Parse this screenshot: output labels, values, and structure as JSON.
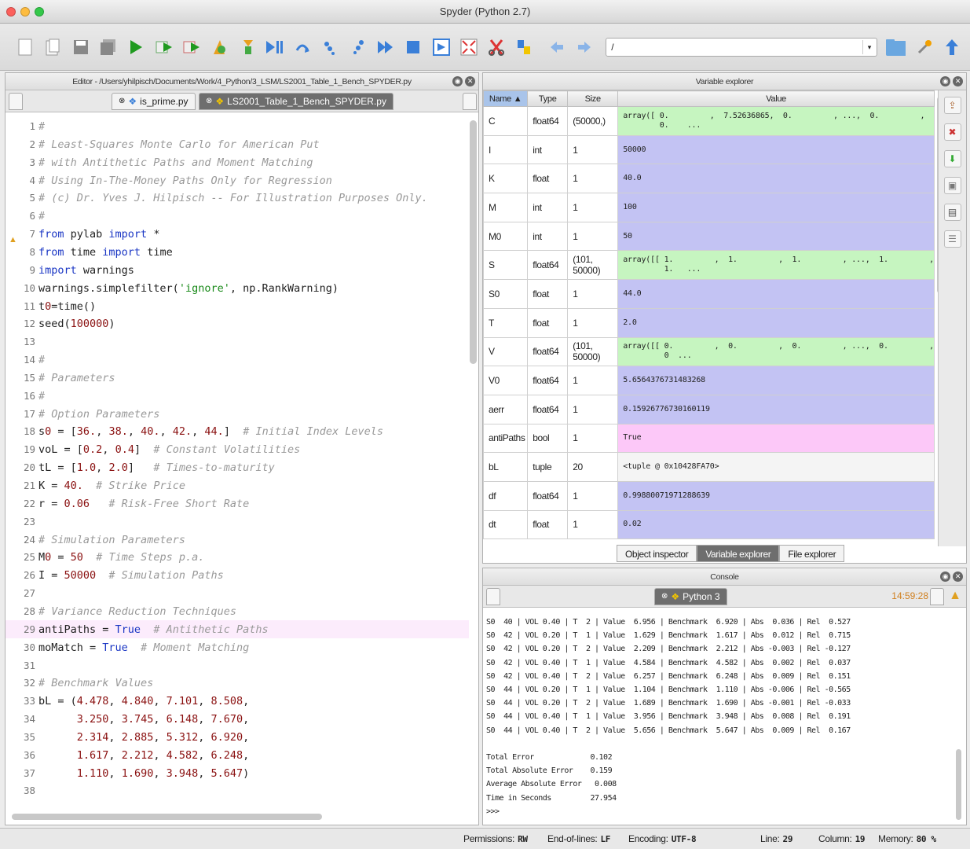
{
  "window": {
    "title": "Spyder (Python 2.7)"
  },
  "toolbar": {
    "path_value": "/"
  },
  "editor": {
    "header": "Editor - /Users/yhilpisch/Documents/Work/4_Python/3_LSM/LS2001_Table_1_Bench_SPYDER.py",
    "tabs": [
      "is_prime.py",
      "LS2001_Table_1_Bench_SPYDER.py"
    ],
    "lines": [
      {
        "n": "1",
        "t": "#"
      },
      {
        "n": "2",
        "t": "# Least-Squares Monte Carlo for American Put"
      },
      {
        "n": "3",
        "t": "# with Antithetic Paths and Moment Matching"
      },
      {
        "n": "4",
        "t": "# Using In-The-Money Paths Only for Regression"
      },
      {
        "n": "5",
        "t": "# (c) Dr. Yves J. Hilpisch -- For Illustration Purposes Only."
      },
      {
        "n": "6",
        "t": "#"
      },
      {
        "n": "7",
        "t": "from pylab import *"
      },
      {
        "n": "8",
        "t": "from time import time"
      },
      {
        "n": "9",
        "t": "import warnings"
      },
      {
        "n": "10",
        "t": "warnings.simplefilter('ignore', np.RankWarning)"
      },
      {
        "n": "11",
        "t": "t0=time()"
      },
      {
        "n": "12",
        "t": "seed(100000)"
      },
      {
        "n": "13",
        "t": ""
      },
      {
        "n": "14",
        "t": "#"
      },
      {
        "n": "15",
        "t": "# Parameters"
      },
      {
        "n": "16",
        "t": "#"
      },
      {
        "n": "17",
        "t": "# Option Parameters"
      },
      {
        "n": "18",
        "t": "s0 = [36., 38., 40., 42., 44.]  # Initial Index Levels"
      },
      {
        "n": "19",
        "t": "voL = [0.2, 0.4]  # Constant Volatilities"
      },
      {
        "n": "20",
        "t": "tL = [1.0, 2.0]   # Times-to-maturity"
      },
      {
        "n": "21",
        "t": "K = 40.  # Strike Price"
      },
      {
        "n": "22",
        "t": "r = 0.06   # Risk-Free Short Rate"
      },
      {
        "n": "23",
        "t": ""
      },
      {
        "n": "24",
        "t": "# Simulation Parameters"
      },
      {
        "n": "25",
        "t": "M0 = 50  # Time Steps p.a."
      },
      {
        "n": "26",
        "t": "I = 50000  # Simulation Paths"
      },
      {
        "n": "27",
        "t": ""
      },
      {
        "n": "28",
        "t": "# Variance Reduction Techniques"
      },
      {
        "n": "29",
        "t": "antiPaths = True  # Antithetic Paths"
      },
      {
        "n": "30",
        "t": "moMatch = True  # Moment Matching"
      },
      {
        "n": "31",
        "t": ""
      },
      {
        "n": "32",
        "t": "# Benchmark Values"
      },
      {
        "n": "33",
        "t": "bL = (4.478, 4.840, 7.101, 8.508,"
      },
      {
        "n": "34",
        "t": "      3.250, 3.745, 6.148, 7.670,"
      },
      {
        "n": "35",
        "t": "      2.314, 2.885, 5.312, 6.920,"
      },
      {
        "n": "36",
        "t": "      1.617, 2.212, 4.582, 6.248,"
      },
      {
        "n": "37",
        "t": "      1.110, 1.690, 3.948, 5.647)"
      },
      {
        "n": "38",
        "t": ""
      }
    ]
  },
  "variable_explorer": {
    "header": "Variable explorer",
    "columns": [
      "Name",
      "Type",
      "Size",
      "Value"
    ],
    "rows": [
      {
        "name": "C",
        "type": "float64",
        "size": "(50000,)",
        "value": "array([ 0.         ,  7.52636865,  0.         , ...,  0.         ,\n        0.    ...",
        "color": "#c6f5c0"
      },
      {
        "name": "I",
        "type": "int",
        "size": "1",
        "value": "50000",
        "color": "#c3c3f3"
      },
      {
        "name": "K",
        "type": "float",
        "size": "1",
        "value": "40.0",
        "color": "#c3c3f3"
      },
      {
        "name": "M",
        "type": "int",
        "size": "1",
        "value": "100",
        "color": "#c3c3f3"
      },
      {
        "name": "M0",
        "type": "int",
        "size": "1",
        "value": "50",
        "color": "#c3c3f3"
      },
      {
        "name": "S",
        "type": "float64",
        "size": "(101, 50000)",
        "value": "array([[ 1.         ,  1.         ,  1.         , ...,  1.         ,\n         1.   ...",
        "color": "#c6f5c0"
      },
      {
        "name": "S0",
        "type": "float",
        "size": "1",
        "value": "44.0",
        "color": "#c3c3f3"
      },
      {
        "name": "T",
        "type": "float",
        "size": "1",
        "value": "2.0",
        "color": "#c3c3f3"
      },
      {
        "name": "V",
        "type": "float64",
        "size": "(101, 50000)",
        "value": "array([[ 0.         ,  0.         ,  0.         , ...,  0.         ,\n         0  ...",
        "color": "#c6f5c0"
      },
      {
        "name": "V0",
        "type": "float64",
        "size": "1",
        "value": "5.6564376731483268",
        "color": "#c3c3f3"
      },
      {
        "name": "aerr",
        "type": "float64",
        "size": "1",
        "value": "0.15926776730160119",
        "color": "#c3c3f3"
      },
      {
        "name": "antiPaths",
        "type": "bool",
        "size": "1",
        "value": "True",
        "color": "#fcc8f8"
      },
      {
        "name": "bL",
        "type": "tuple",
        "size": "20",
        "value": "<tuple @ 0x10428FA70>",
        "color": "#f4f4f4"
      },
      {
        "name": "df",
        "type": "float64",
        "size": "1",
        "value": "0.99880071971288639",
        "color": "#c3c3f3"
      },
      {
        "name": "dt",
        "type": "float",
        "size": "1",
        "value": "0.02",
        "color": "#c3c3f3"
      }
    ],
    "bottom_tabs": [
      "Object inspector",
      "Variable explorer",
      "File explorer"
    ]
  },
  "console": {
    "header": "Console",
    "tab": "Python 3",
    "time": "14:59:28",
    "output": "S0  40 | VOL 0.40 | T  2 | Value  6.956 | Benchmark  6.920 | Abs  0.036 | Rel  0.527\nS0  42 | VOL 0.20 | T  1 | Value  1.629 | Benchmark  1.617 | Abs  0.012 | Rel  0.715\nS0  42 | VOL 0.20 | T  2 | Value  2.209 | Benchmark  2.212 | Abs -0.003 | Rel -0.127\nS0  42 | VOL 0.40 | T  1 | Value  4.584 | Benchmark  4.582 | Abs  0.002 | Rel  0.037\nS0  42 | VOL 0.40 | T  2 | Value  6.257 | Benchmark  6.248 | Abs  0.009 | Rel  0.151\nS0  44 | VOL 0.20 | T  1 | Value  1.104 | Benchmark  1.110 | Abs -0.006 | Rel -0.565\nS0  44 | VOL 0.20 | T  2 | Value  1.689 | Benchmark  1.690 | Abs -0.001 | Rel -0.033\nS0  44 | VOL 0.40 | T  1 | Value  3.956 | Benchmark  3.948 | Abs  0.008 | Rel  0.191\nS0  44 | VOL 0.40 | T  2 | Value  5.656 | Benchmark  5.647 | Abs  0.009 | Rel  0.167\n\nTotal Error             0.102\nTotal Absolute Error    0.159\nAverage Absolute Error   0.008\nTime in Seconds         27.954\n>>>"
  },
  "status": {
    "permissions_label": "Permissions:",
    "permissions": "RW",
    "eol_label": "End-of-lines:",
    "eol": "LF",
    "encoding_label": "Encoding:",
    "encoding": "UTF-8",
    "line_label": "Line:",
    "line": "29",
    "column_label": "Column:",
    "column": "19",
    "memory_label": "Memory:",
    "memory": "80 %"
  }
}
